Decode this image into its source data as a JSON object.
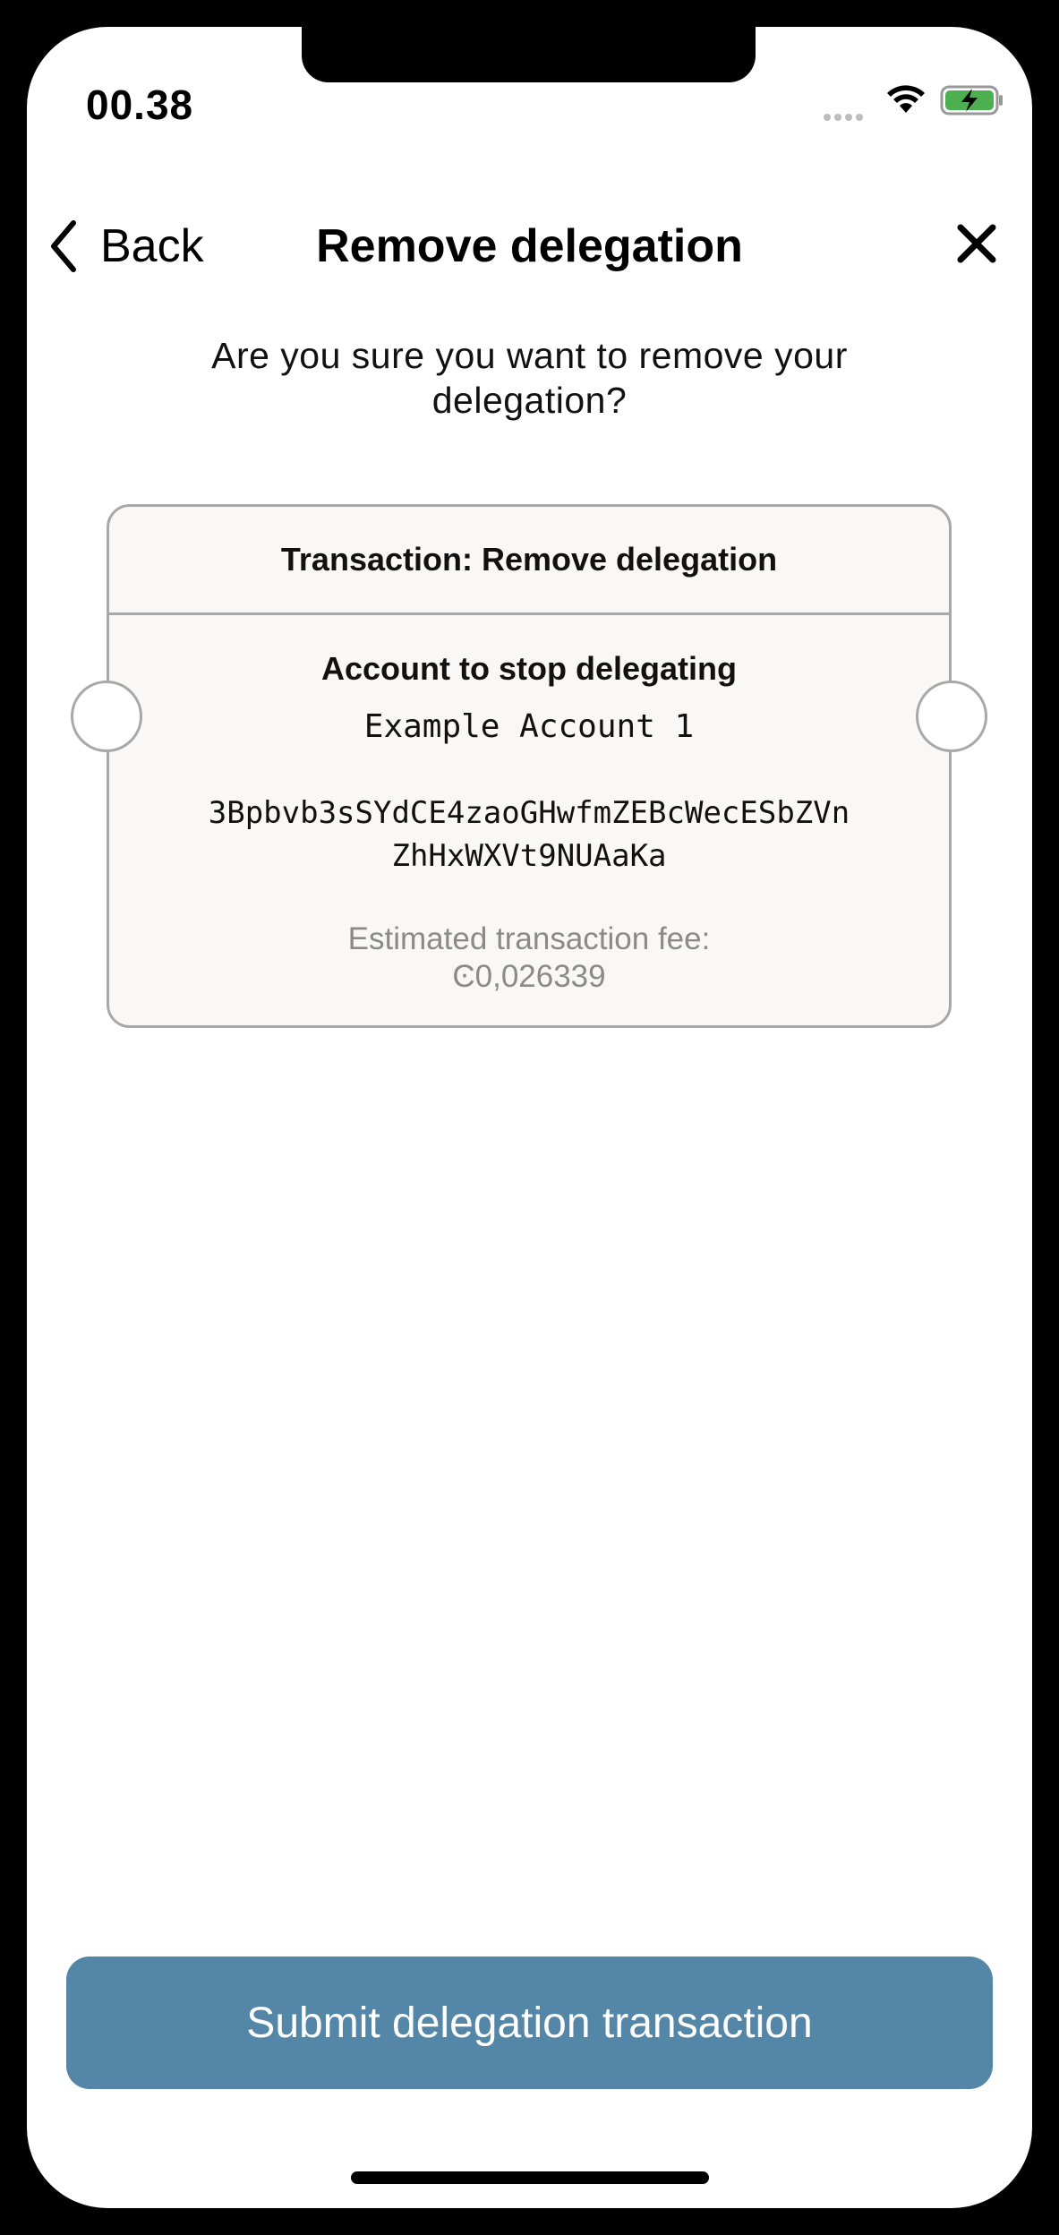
{
  "status_bar": {
    "time": "00.38",
    "icons": [
      "signal-dots-icon",
      "wifi-icon",
      "battery-charging-icon"
    ],
    "battery_color": "#4caf50"
  },
  "nav": {
    "back_label": "Back",
    "title": "Remove delegation",
    "icons": [
      "chevron-left-icon",
      "close-icon"
    ]
  },
  "question": "Are you sure you want to remove your delegation?",
  "card": {
    "header": "Transaction: Remove delegation",
    "account_title": "Account to stop delegating",
    "account_name": "Example Account 1",
    "address_line1": "3Bpbvb3sSYdCE4zaoGHwfmZEBcWecESbZVn",
    "address_line2": "ZhHxWXVt9NUAaKa",
    "fee_label": "Estimated transaction fee:",
    "fee_value": "Ͼ0,026339"
  },
  "submit_label": "Submit delegation transaction",
  "colors": {
    "button": "#5486a8",
    "card_bg": "#f9f8f6",
    "card_border": "#a8a8a8",
    "muted_text": "#8a8a8a"
  }
}
